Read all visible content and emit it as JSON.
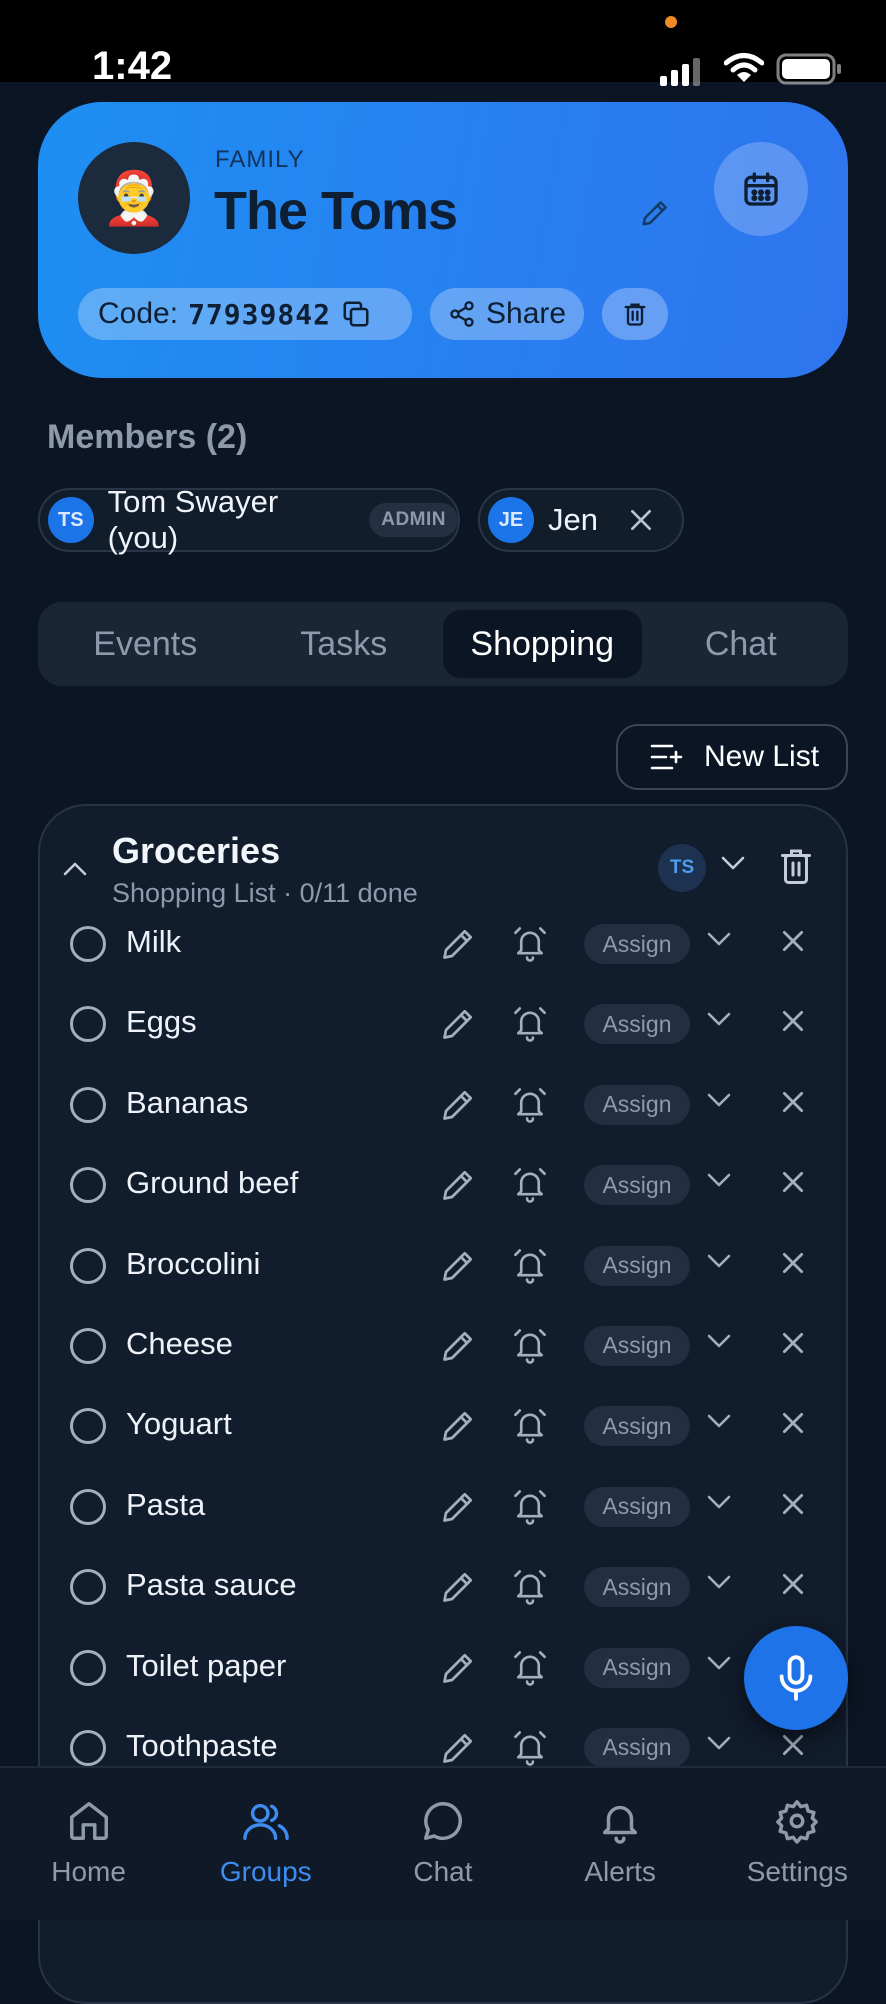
{
  "status_bar": {
    "time": "1:42"
  },
  "group": {
    "kicker": "FAMILY",
    "name": "The Toms",
    "avatar_emoji": "🤶",
    "code_label": "Code:",
    "code_value": "77939842",
    "share_label": "Share"
  },
  "members": {
    "title": "Members (2)",
    "list": [
      {
        "initials": "TS",
        "name": "Tom Swayer (you)",
        "badge": "ADMIN"
      },
      {
        "initials": "JE",
        "name": "Jen"
      }
    ]
  },
  "tabs": [
    {
      "label": "Events"
    },
    {
      "label": "Tasks"
    },
    {
      "label": "Shopping",
      "active": true
    },
    {
      "label": "Chat"
    }
  ],
  "new_list_label": "New List",
  "list": {
    "title": "Groceries",
    "subtitle": "Shopping List · 0/11 done",
    "assignee_initials": "TS",
    "assign_label": "Assign",
    "items": [
      {
        "name": "Milk"
      },
      {
        "name": "Eggs"
      },
      {
        "name": "Bananas"
      },
      {
        "name": "Ground beef"
      },
      {
        "name": "Broccolini"
      },
      {
        "name": "Cheese"
      },
      {
        "name": "Yoguart"
      },
      {
        "name": "Pasta"
      },
      {
        "name": "Pasta sauce"
      },
      {
        "name": "Toilet paper"
      },
      {
        "name": "Toothpaste"
      }
    ]
  },
  "nav": [
    {
      "label": "Home",
      "icon": "home-icon"
    },
    {
      "label": "Groups",
      "icon": "users-icon",
      "active": true
    },
    {
      "label": "Chat",
      "icon": "chat-bubble-icon"
    },
    {
      "label": "Alerts",
      "icon": "bell-icon"
    },
    {
      "label": "Settings",
      "icon": "gear-icon"
    }
  ],
  "colors": {
    "background": "#0b1524",
    "header_gradient_start": "#1e8ff3",
    "header_gradient_end": "#2f74ee",
    "accent": "#1e73e8",
    "nav_active": "#3d8cf0"
  }
}
